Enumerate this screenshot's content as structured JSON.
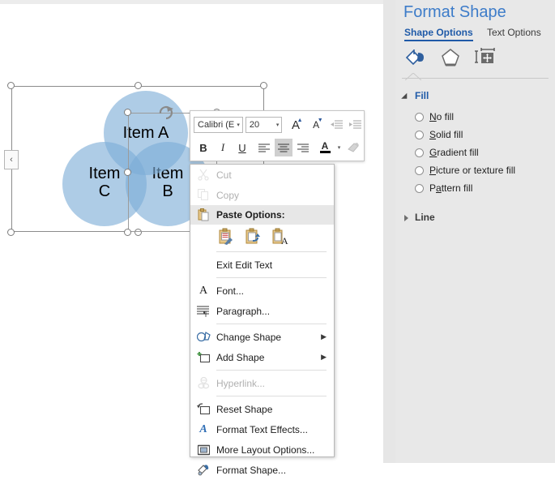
{
  "canvas": {
    "smartart": {
      "circles": [
        {
          "id": "a",
          "label_line1": "Item A",
          "label_line2": ""
        },
        {
          "id": "b",
          "label_line1": "Item",
          "label_line2": "B"
        },
        {
          "id": "c",
          "label_line1": "Item",
          "label_line2": "C"
        }
      ],
      "text_pane_tab": "‹",
      "rotate_icon": "rotate-icon"
    }
  },
  "minibar": {
    "font_name": "Calibri (E",
    "font_size": "20",
    "caret": "▾",
    "buttons": {
      "grow_font": "A",
      "shrink_font": "A",
      "decrease_indent": "decrease-indent-icon",
      "increase_indent": "increase-indent-icon",
      "bold": "B",
      "italic": "I",
      "underline": "U",
      "align_left": "align-left-icon",
      "align_center": "align-center-icon",
      "align_right": "align-right-icon",
      "font_color": "A",
      "format_painter": "format-painter-icon"
    }
  },
  "context_menu": {
    "items": [
      {
        "label": "Cut",
        "icon": "scissors-icon",
        "disabled": true,
        "submenu": false,
        "accel_index": 2
      },
      {
        "label": "Copy",
        "icon": "copy-icon",
        "disabled": true,
        "submenu": false
      },
      {
        "label": "Paste Options:",
        "icon": "paste-icon",
        "header": true
      },
      {
        "label": "Exit Edit Text",
        "icon": "",
        "disabled": false,
        "submenu": false
      },
      {
        "label": "Font...",
        "icon": "font-a-icon",
        "disabled": false,
        "submenu": false
      },
      {
        "label": "Paragraph...",
        "icon": "paragraph-icon",
        "disabled": false,
        "submenu": false
      },
      {
        "label": "Change Shape",
        "icon": "change-shape-icon",
        "disabled": false,
        "submenu": true
      },
      {
        "label": "Add Shape",
        "icon": "add-shape-icon",
        "disabled": false,
        "submenu": true
      },
      {
        "label": "Hyperlink...",
        "icon": "hyperlink-icon",
        "disabled": true,
        "submenu": false
      },
      {
        "label": "Reset Shape",
        "icon": "reset-shape-icon",
        "disabled": false,
        "submenu": false
      },
      {
        "label": "Format Text Effects...",
        "icon": "text-effects-icon",
        "disabled": false,
        "submenu": false
      },
      {
        "label": "More Layout Options...",
        "icon": "layout-options-icon",
        "disabled": false,
        "submenu": false
      },
      {
        "label": "Format Shape...",
        "icon": "format-shape-icon",
        "disabled": false,
        "submenu": false
      }
    ],
    "paste_icons": [
      "paste-keep-source-formatting-icon",
      "paste-use-destination-theme-icon",
      "paste-text-only-icon"
    ],
    "submenu_arrow": "▶"
  },
  "panel": {
    "title": "Format Shape",
    "tabs": [
      {
        "label": "Shape Options",
        "active": true
      },
      {
        "label": "Text Options",
        "active": false
      }
    ],
    "icon_tabs": [
      "fill-and-line-icon",
      "effects-icon",
      "size-and-properties-icon"
    ],
    "sections": [
      {
        "label": "Fill",
        "expanded": true
      },
      {
        "label": "Line",
        "expanded": false
      }
    ],
    "fill_options": [
      {
        "label": "No fill",
        "selected": false
      },
      {
        "label": "Solid fill",
        "selected": false
      },
      {
        "label": "Gradient fill",
        "selected": false
      },
      {
        "label": "Picture or texture fill",
        "selected": false
      },
      {
        "label": "Pattern fill",
        "selected": false
      }
    ]
  },
  "colors": {
    "accent_blue": "#3d7cc9",
    "tab_active_blue": "#1f5aa8",
    "circle_fill": "#a9c8e5",
    "circle_overlap": "#7fb0dc",
    "panel_bg": "#e8e8e8",
    "menu_header_bg": "#e7e7e7"
  }
}
